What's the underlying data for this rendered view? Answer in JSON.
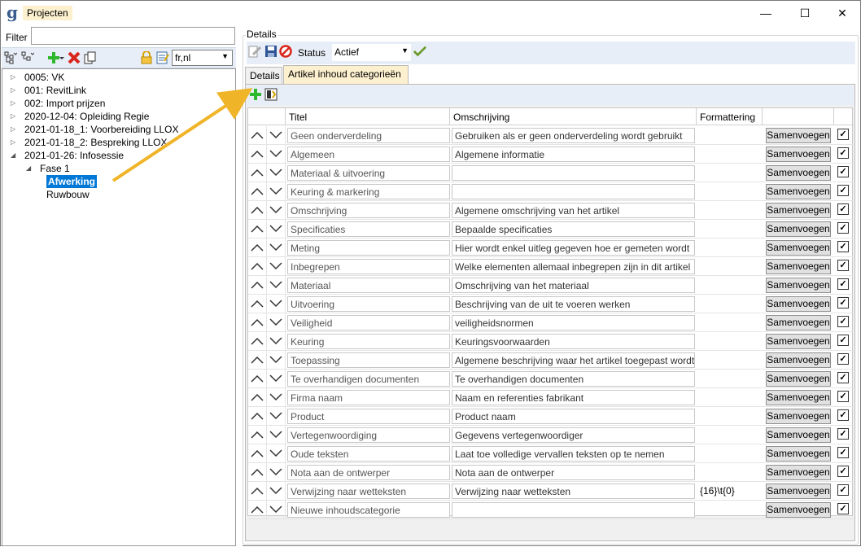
{
  "window": {
    "title": "Projecten",
    "app_icon": "g",
    "minimize_label": "—",
    "maximize_label": "☐",
    "close_label": "✕"
  },
  "left": {
    "filter_label": "Filter",
    "filter_value": "",
    "language": "fr,nl",
    "tree": [
      {
        "label": "0005: VK",
        "level": 0,
        "toggle": "▷"
      },
      {
        "label": "001: RevitLink",
        "level": 0,
        "toggle": "▷"
      },
      {
        "label": "002: Import prijzen",
        "level": 0,
        "toggle": "▷"
      },
      {
        "label": "2020-12-04: Opleiding Regie",
        "level": 0,
        "toggle": "▷"
      },
      {
        "label": "2021-01-18_1: Voorbereiding LLOX",
        "level": 0,
        "toggle": "▷"
      },
      {
        "label": "2021-01-18_2: Bespreking LLOX",
        "level": 0,
        "toggle": "▷"
      },
      {
        "label": "2021-01-26: Infosessie",
        "level": 0,
        "toggle": "◢"
      },
      {
        "label": "Fase 1",
        "level": 1,
        "toggle": "◢"
      },
      {
        "label": "Afwerking",
        "level": 2,
        "toggle": ""
      },
      {
        "label": "Ruwbouw",
        "level": 2,
        "toggle": ""
      }
    ]
  },
  "right": {
    "group_label": "Details",
    "status_label": "Status",
    "status_value": "Actief",
    "tabs": [
      {
        "label": "Details",
        "active": false
      },
      {
        "label": "Artikel inhoud categorieën",
        "active": true
      }
    ],
    "columns": [
      "Titel",
      "Omschrijving",
      "Formattering",
      ""
    ],
    "merge_label": "Samenvoegen",
    "check_mark": "✓",
    "rows": [
      {
        "titel": "Geen onderverdeling",
        "omschrijving": "Gebruiken als er geen onderverdeling wordt gebruikt",
        "formattering": ""
      },
      {
        "titel": "Algemeen",
        "omschrijving": "Algemene informatie",
        "formattering": ""
      },
      {
        "titel": "Materiaal & uitvoering",
        "omschrijving": "",
        "formattering": ""
      },
      {
        "titel": "Keuring & markering",
        "omschrijving": "",
        "formattering": ""
      },
      {
        "titel": "Omschrijving",
        "omschrijving": "Algemene omschrijving van het artikel",
        "formattering": ""
      },
      {
        "titel": "Specificaties",
        "omschrijving": "Bepaalde specificaties",
        "formattering": ""
      },
      {
        "titel": "Meting",
        "omschrijving": "Hier wordt enkel uitleg gegeven hoe er gemeten wordt",
        "formattering": ""
      },
      {
        "titel": "Inbegrepen",
        "omschrijving": "Welke elementen allemaal inbegrepen zijn in dit artikel",
        "formattering": ""
      },
      {
        "titel": "Materiaal",
        "omschrijving": "Omschrijving van het materiaal",
        "formattering": ""
      },
      {
        "titel": "Uitvoering",
        "omschrijving": "Beschrijving van de uit te voeren werken",
        "formattering": ""
      },
      {
        "titel": "Veiligheid",
        "omschrijving": "veiligheidsnormen",
        "formattering": ""
      },
      {
        "titel": "Keuring",
        "omschrijving": "Keuringsvoorwaarden",
        "formattering": ""
      },
      {
        "titel": "Toepassing",
        "omschrijving": "Algemene beschrijving waar het artikel toegepast wordt",
        "formattering": ""
      },
      {
        "titel": "Te overhandigen documenten",
        "omschrijving": "Te overhandigen documenten",
        "formattering": ""
      },
      {
        "titel": "Firma naam",
        "omschrijving": "Naam en referenties fabrikant",
        "formattering": ""
      },
      {
        "titel": "Product",
        "omschrijving": "Product naam",
        "formattering": ""
      },
      {
        "titel": "Vertegenwoordiging",
        "omschrijving": "Gegevens vertegenwoordiger",
        "formattering": ""
      },
      {
        "titel": "Oude teksten",
        "omschrijving": "Laat toe volledige vervallen teksten op te nemen",
        "formattering": ""
      },
      {
        "titel": "Nota aan de ontwerper",
        "omschrijving": "Nota aan de ontwerper",
        "formattering": ""
      },
      {
        "titel": "Verwijzing naar wetteksten",
        "omschrijving": "Verwijzing naar wetteksten",
        "formattering": "{16}\\t{0}"
      },
      {
        "titel": "Nieuwe inhoudscategorie",
        "omschrijving": "",
        "formattering": ""
      }
    ]
  },
  "colors": {
    "accent": "#0078d7",
    "title_highlight": "#fdf0cf",
    "toolbar_bg": "#e8eef7",
    "arrow": "#f0b429"
  }
}
